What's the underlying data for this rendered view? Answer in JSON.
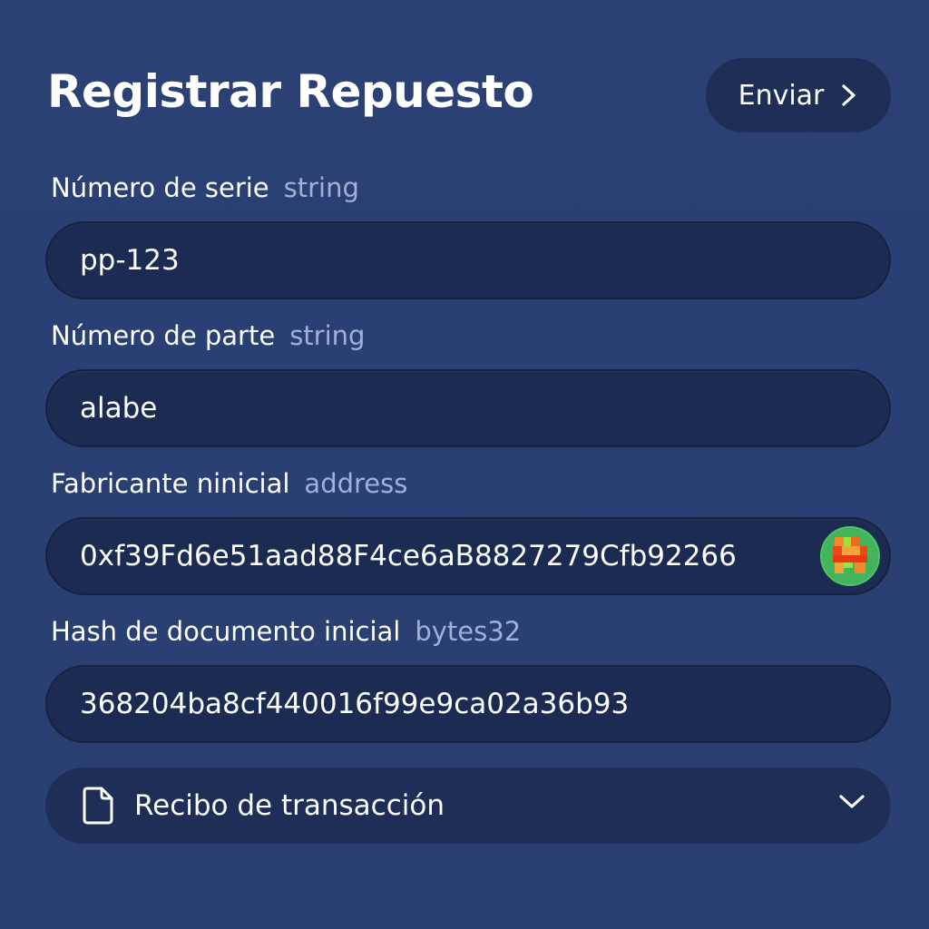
{
  "form": {
    "title": "Registrar Repuesto",
    "submit_label": "Enviar",
    "submit_icon": "chevron-right-icon"
  },
  "fields": [
    {
      "label": "Número de serie",
      "type": "string",
      "value": "pp-123"
    },
    {
      "label": "Número de parte",
      "type": "string",
      "value": "alabe"
    },
    {
      "label": "Fabricante ninicial",
      "type": "address",
      "value": "0xf39Fd6e51aad88F4ce6aB8827279Cfb92266",
      "icon": "identicon-avatar-icon"
    },
    {
      "label": "Hash de documento inicial",
      "type": "bytes32",
      "value": "368204ba8cf440016f99e9ca02a36b93"
    }
  ],
  "receipt": {
    "label": "Recibo de transacción",
    "icon": "document-icon",
    "toggle_icon": "chevron-down-icon"
  },
  "colors": {
    "background": "#2a4073",
    "input_background": "#1c2b52",
    "button_background": "#1e2e57",
    "type_hint": "#9fb1d6",
    "text": "#ffffff"
  }
}
